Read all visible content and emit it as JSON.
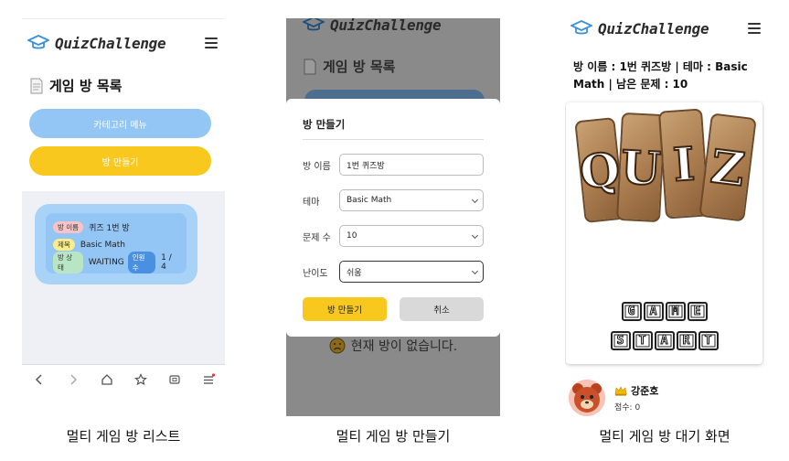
{
  "app": {
    "name": "QuizChallenge"
  },
  "screen1": {
    "section_title": "게임 방 목록",
    "category_button": "카테고리 메뉴",
    "create_button": "방 만들기",
    "room": {
      "name_label": "방 이름",
      "name_value": "퀴즈 1번 방",
      "topic_label": "제목",
      "topic_value": "Basic Math",
      "status_label": "방 상태",
      "status_value": "WAITING",
      "players_label": "인원수",
      "players_value": "1 / 4"
    },
    "caption": "멀티 게임 방 리스트"
  },
  "screen2": {
    "section_title": "게임 방 목록",
    "modal": {
      "title": "방 만들기",
      "fields": [
        {
          "label": "방 이름",
          "value": "1번 퀴즈방",
          "type": "input"
        },
        {
          "label": "테마",
          "value": "Basic Math",
          "type": "select"
        },
        {
          "label": "문제 수",
          "value": "10",
          "type": "select"
        },
        {
          "label": "난이도",
          "value": "쉬움",
          "type": "select"
        }
      ],
      "create_button": "방 만들기",
      "cancel_button": "취소"
    },
    "empty_message": "현재 방이 없습니다.",
    "caption": "멀티 게임 방 만들기"
  },
  "screen3": {
    "room_info": "방 이름 : 1번 퀴즈방 | 테마 : Basic Math | 남은 문제 : 10",
    "quiz_letters": [
      "Q",
      "U",
      "I",
      "Z"
    ],
    "game_letters": [
      "G",
      "A",
      "M",
      "E"
    ],
    "start_letters": [
      "S",
      "T",
      "A",
      "R",
      "T"
    ],
    "player": {
      "name": "강준호",
      "score": "점수: 0"
    },
    "caption": "멀티 게임 방 대기 화면"
  },
  "colors": {
    "blue": "#93c5f5",
    "yellow": "#f8c81f",
    "wood": "#a97c4f"
  }
}
